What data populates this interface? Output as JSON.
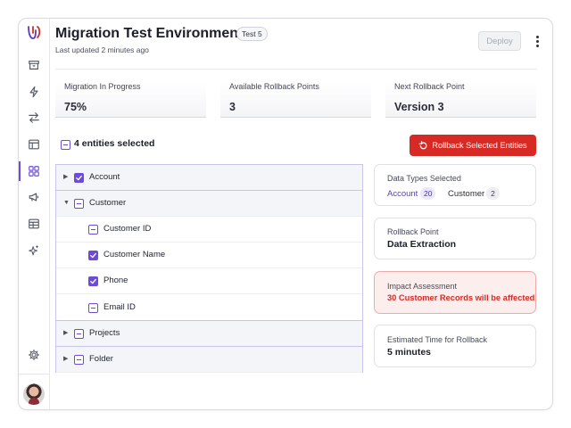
{
  "header": {
    "title": "Migration Test Environment",
    "badge": "Test 5",
    "updated": "Last updated 2 minutes ago",
    "deploy_label": "Deploy",
    "more_icon": "kebab-vertical-icon"
  },
  "sidebar": {
    "logo_icon": "app-logo-icon",
    "items": [
      {
        "icon": "archive-icon"
      },
      {
        "icon": "lightning-icon"
      },
      {
        "icon": "transfer-arrows-icon"
      },
      {
        "icon": "layout-icon"
      },
      {
        "icon": "grid-icon",
        "active": true
      },
      {
        "icon": "megaphone-icon"
      },
      {
        "icon": "table-icon"
      },
      {
        "icon": "sparkles-icon"
      }
    ],
    "settings_icon": "gear-icon",
    "avatar": "user-avatar"
  },
  "stats": [
    {
      "label": "Migration In Progress",
      "value": "75%"
    },
    {
      "label": "Available Rollback Points",
      "value": "3"
    },
    {
      "label": "Next Rollback Point",
      "value": "Version 3"
    }
  ],
  "selection": {
    "text": "4 entities selected",
    "rollback_label": "Rollback Selected Entities"
  },
  "tree": [
    {
      "label": "Account",
      "level": 0,
      "state": "checked",
      "expanded": false
    },
    {
      "label": "Customer",
      "level": 0,
      "state": "partial",
      "expanded": true
    },
    {
      "label": "Customer ID",
      "level": 1,
      "state": "partial"
    },
    {
      "label": "Customer Name",
      "level": 1,
      "state": "checked"
    },
    {
      "label": "Phone",
      "level": 1,
      "state": "checked"
    },
    {
      "label": "Email ID",
      "level": 1,
      "state": "partial"
    },
    {
      "label": "Projects",
      "level": 0,
      "state": "partial",
      "expanded": false
    },
    {
      "label": "Folder",
      "level": 0,
      "state": "partial",
      "expanded": false
    }
  ],
  "cards": {
    "data_types": {
      "label": "Data Types Selected",
      "tags": [
        {
          "name": "Account",
          "count": "20",
          "accent": true
        },
        {
          "name": "Customer",
          "count": "2",
          "accent": false
        }
      ]
    },
    "rollback_point": {
      "label": "Rollback Point",
      "value": "Data Extraction"
    },
    "impact": {
      "label": "Impact Assessment",
      "value": "30 Customer Records will be affected"
    },
    "time": {
      "label": "Estimated Time for Rollback",
      "value": "5 minutes"
    }
  },
  "colors": {
    "accent": "#6d4bd8",
    "danger": "#d72a24",
    "impact_bg": "#fdeeee"
  }
}
